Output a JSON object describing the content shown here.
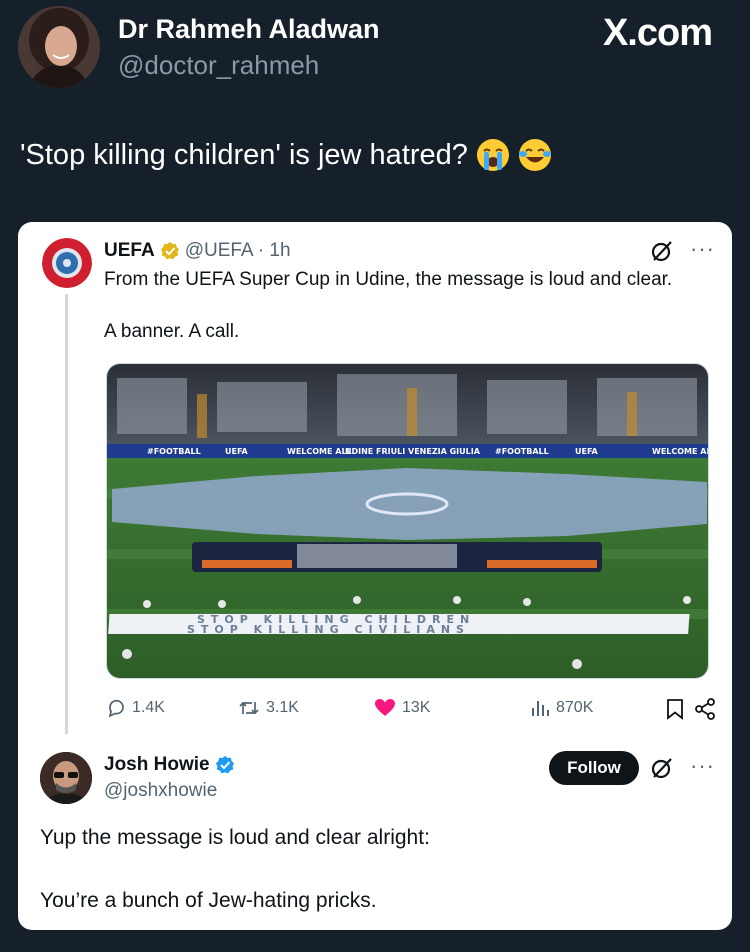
{
  "header": {
    "display_name": "Dr Rahmeh Aladwan",
    "handle": "@doctor_rahmeh",
    "brand": "X.com"
  },
  "post": {
    "text": "'Stop killing children' is jew hatred?",
    "emojis": [
      "loudly-crying-face",
      "face-with-tears-of-joy"
    ]
  },
  "quoted": {
    "name": "UEFA",
    "handle_time": "@UEFA · 1h",
    "text_line1": "From the UEFA Super Cup in Udine, the message is loud and clear.",
    "text_line2": "A banner. A call.",
    "image": {
      "ad_boards": [
        "#FOOTBALL",
        "UEFA",
        "WELCOME ALL",
        "UDINE FRIULI VENEZIA GIULIA",
        "#FOOTBALL",
        "UEFA",
        "WELCOME ALL"
      ],
      "banner_line1": "STOP KILLING CHILDREN",
      "banner_line2": "STOP KILLING CIVILIANS"
    },
    "stats": {
      "replies": "1.4K",
      "reposts": "3.1K",
      "likes": "13K",
      "views": "870K"
    },
    "colors": {
      "like": "#f91880",
      "verified_gold": "#e2b719",
      "verified_blue": "#1d9bf0"
    }
  },
  "reply": {
    "name": "Josh Howie",
    "handle": "@joshxhowie",
    "follow_label": "Follow",
    "text_line1": "Yup the message is loud and clear alright:",
    "text_line2": "You’re a bunch of Jew-hating pricks."
  }
}
